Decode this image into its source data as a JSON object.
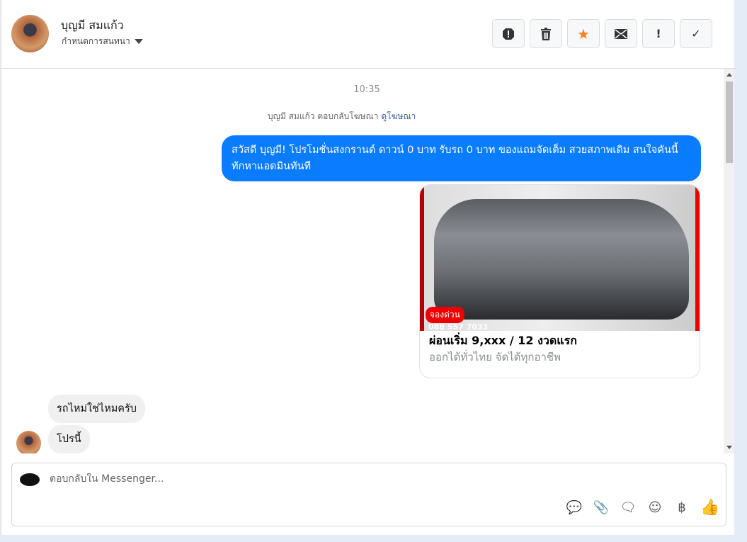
{
  "header": {
    "name": "บุญมี สมแก้ว",
    "assign_label": "กำหนดการสนทนา",
    "actions": [
      {
        "icon": "spam-icon",
        "glyph": "⬤"
      },
      {
        "icon": "trash-icon",
        "glyph": "🗑"
      },
      {
        "icon": "star-icon",
        "glyph": "★"
      },
      {
        "icon": "mail-icon",
        "glyph": "✉"
      },
      {
        "icon": "important-icon",
        "glyph": "!"
      },
      {
        "icon": "check-icon",
        "glyph": "✓"
      }
    ]
  },
  "chat": {
    "time": "10:35",
    "replied_text": "บุญมี สมแก้ว ตอบกลับโฆษณา",
    "view_ad_link": "ดูโฆษณา",
    "outgoing": "สวัสดี บุญมี! โปรโมชั่นสงกรานต์ ดาวน์ 0 บาท รับรถ 0 บาท ของแถมจัดเต็ม สวยสภาพเดิม สนใจคันนี้ทักหาแอดมินทันที",
    "card": {
      "badge": "จองด่วน",
      "phone": "088 557 7033",
      "title": "ผ่อนเริ่ม 9,xxx / 12 งวดแรก",
      "subtitle": "ออกได้ทั่วไทย จัดได้ทุกอาชีพ"
    },
    "incoming": [
      "รถไหม่ใช่ไหมครับ",
      "โปรนี้"
    ]
  },
  "composer": {
    "placeholder": "ตอบกลับใน Messenger...",
    "baht": "฿"
  },
  "colors": {
    "accent": "#0a7cff",
    "star": "#f5841f"
  }
}
